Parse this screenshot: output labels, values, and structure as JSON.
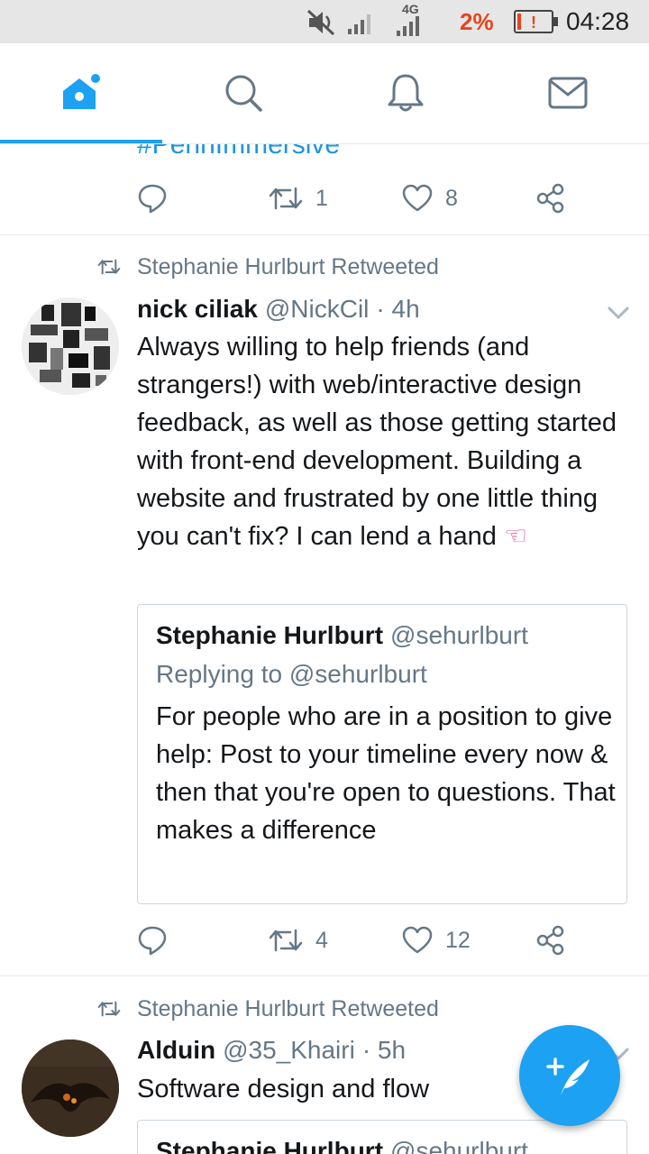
{
  "status_bar": {
    "network_label": "4G",
    "battery_percent": "2%",
    "time": "04:28"
  },
  "nav": {
    "tabs": [
      {
        "name": "home",
        "icon": "home-icon",
        "active": true
      },
      {
        "name": "search",
        "icon": "search-icon",
        "active": false
      },
      {
        "name": "notifications",
        "icon": "bell-icon",
        "active": false
      },
      {
        "name": "messages",
        "icon": "mail-icon",
        "active": false
      }
    ]
  },
  "prev_tweet": {
    "hashtag": "#PennImmersive",
    "reply_count": "",
    "retweet_count": "1",
    "like_count": "8"
  },
  "tweets": [
    {
      "retweeted_by": "Stephanie Hurlburt Retweeted",
      "name": "nick ciliak",
      "handle": "@NickCil",
      "time": "· 4h",
      "text": "Always willing to help friends (and strangers!) with web/interactive design feedback, as well as those getting started with front-end development. Building a website and frustrated by one little thing you can't fix? I can lend a hand",
      "emoji": "☜",
      "quote": {
        "name": "Stephanie Hurlburt",
        "handle": "@sehurlburt",
        "replying_to": "Replying to @sehurlburt",
        "text": "For people who are in a position to give help: Post to your timeline every now & then that you're open to questions. That makes a difference"
      },
      "retweet_count": "4",
      "like_count": "12"
    },
    {
      "retweeted_by": "Stephanie Hurlburt Retweeted",
      "name": "Alduin",
      "handle": "@35_Khairi",
      "time": "· 5h",
      "text": "Software design and flow",
      "quote": {
        "name": "Stephanie Hurlburt",
        "handle": "@sehurlburt"
      }
    }
  ],
  "fab": {
    "icon": "compose-tweet-icon"
  },
  "colors": {
    "accent": "#1da1f2",
    "link": "#1b95e0",
    "muted": "#657786",
    "battery_low": "#e8451c"
  }
}
